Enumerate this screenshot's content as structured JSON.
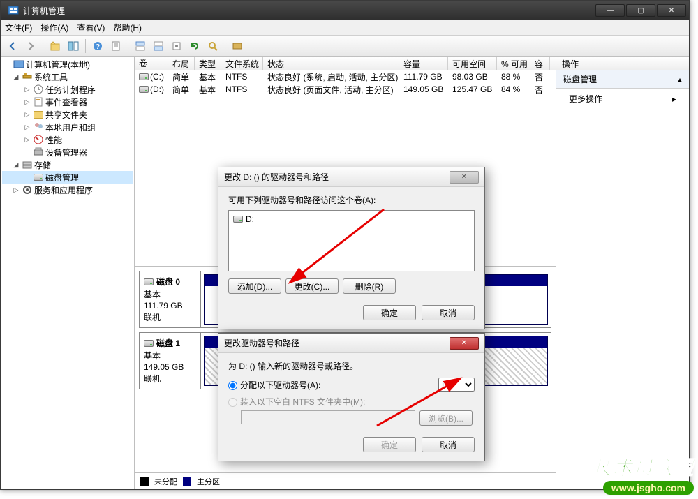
{
  "window": {
    "title": "计算机管理"
  },
  "menubar": {
    "file": "文件(F)",
    "action": "操作(A)",
    "view": "查看(V)",
    "help": "帮助(H)"
  },
  "tree": {
    "root": "计算机管理(本地)",
    "system_tools": "系统工具",
    "task_scheduler": "任务计划程序",
    "event_viewer": "事件查看器",
    "shared_folders": "共享文件夹",
    "local_users": "本地用户和组",
    "performance": "性能",
    "device_manager": "设备管理器",
    "storage": "存储",
    "disk_management": "磁盘管理",
    "services_apps": "服务和应用程序"
  },
  "columns": {
    "volume": "卷",
    "layout": "布局",
    "type": "类型",
    "fs": "文件系统",
    "status": "状态",
    "capacity": "容量",
    "free": "可用空间",
    "pct": "% 可用",
    "fault": "容"
  },
  "volumes": [
    {
      "name": "(C:)",
      "layout": "简单",
      "type": "基本",
      "fs": "NTFS",
      "status": "状态良好 (系统, 启动, 活动, 主分区)",
      "capacity": "111.79 GB",
      "free": "98.03 GB",
      "pct": "88 %",
      "fault": "否"
    },
    {
      "name": "(D:)",
      "layout": "简单",
      "type": "基本",
      "fs": "NTFS",
      "status": "状态良好 (页面文件, 活动, 主分区)",
      "capacity": "149.05 GB",
      "free": "125.47 GB",
      "pct": "84 %",
      "fault": "否"
    }
  ],
  "disks": [
    {
      "label": "磁盘 0",
      "type": "基本",
      "size": "111.79 GB",
      "state": "联机"
    },
    {
      "label": "磁盘 1",
      "type": "基本",
      "size": "149.05 GB",
      "state": "联机"
    }
  ],
  "legend": {
    "unalloc": "未分配",
    "primary": "主分区"
  },
  "actions": {
    "header": "操作",
    "section": "磁盘管理",
    "more": "更多操作"
  },
  "dialog1": {
    "title": "更改 D: () 的驱动器号和路径",
    "instruction": "可用下列驱动器号和路径访问这个卷(A):",
    "entry": "D:",
    "add": "添加(D)...",
    "change": "更改(C)...",
    "remove": "删除(R)",
    "ok": "确定",
    "cancel": "取消"
  },
  "dialog2": {
    "title": "更改驱动器号和路径",
    "instruction": "为 D: () 输入新的驱动器号或路径。",
    "assign_label": "分配以下驱动器号(A):",
    "mount_label": "装入以下空白 NTFS 文件夹中(M):",
    "letter": "D",
    "browse": "浏览(B)...",
    "ok": "确定",
    "cancel": "取消"
  },
  "watermark": {
    "line1": "技术员联盟",
    "line2": "www.jsgho.com"
  }
}
